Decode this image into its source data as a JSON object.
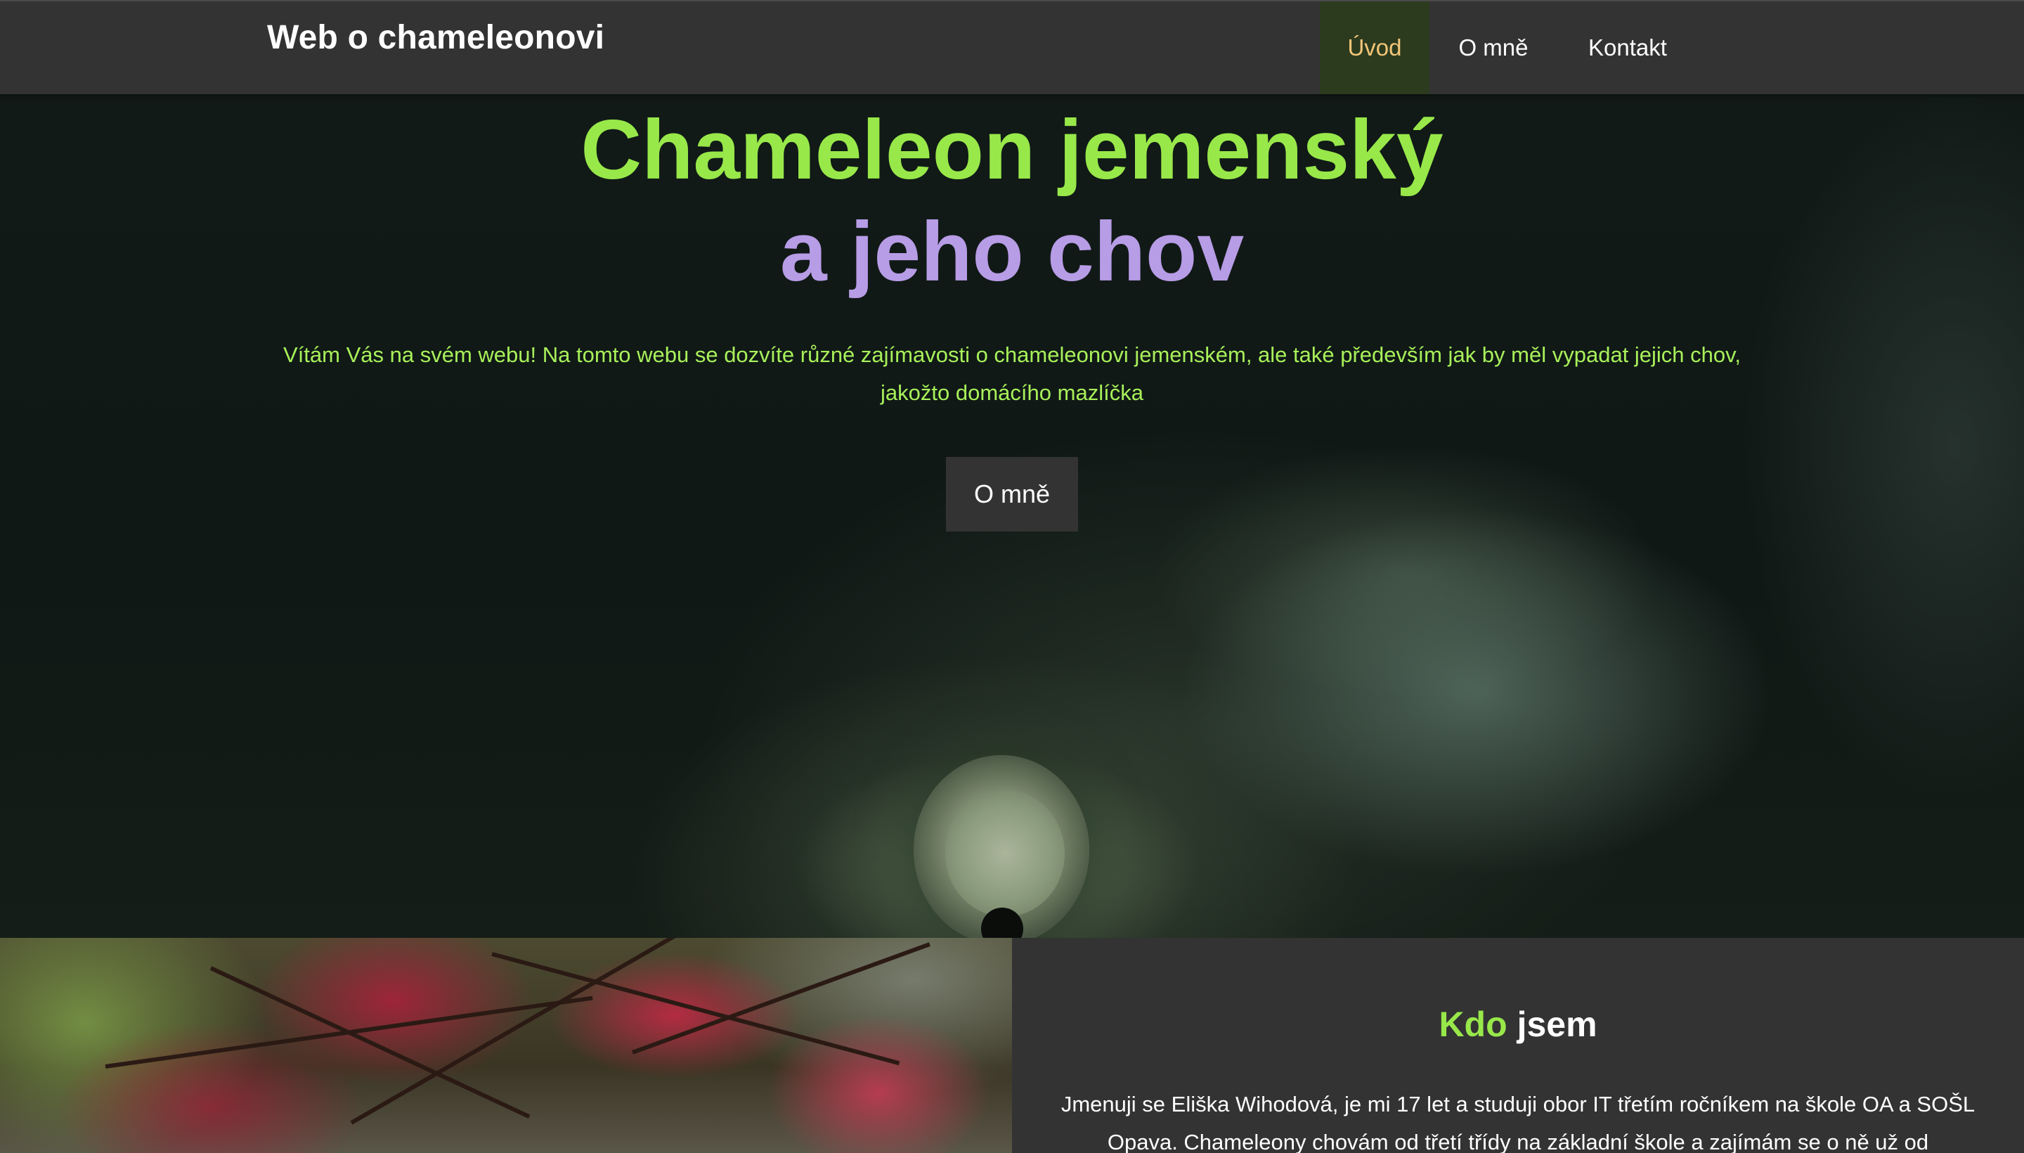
{
  "navbar": {
    "brand": "Web o chameleonovi",
    "items": [
      {
        "label": "Úvod",
        "active": true
      },
      {
        "label": "O mně",
        "active": false
      },
      {
        "label": "Kontakt",
        "active": false
      }
    ],
    "active_bg": "#2c3b1e",
    "active_color": "#f2c679"
  },
  "hero": {
    "title_line1": "Chameleon jemenský",
    "title_line2": "a jeho chov",
    "text": "Vítám Vás na svém webu! Na tomto webu se dozvíte různé zajímavosti o chameleonovi jemenském, ale také především jak by měl vypadat jejich chov, jakožto domácího mazlíčka",
    "button": "O mně",
    "title1_color": "#98e84a",
    "title2_color": "#b79ce6"
  },
  "about": {
    "title_green": "Kdo",
    "title_white": "jsem",
    "text": "Jmenuji se Eliška Wihodová, je mi 17 let a studuji obor IT třetím ročníkem na škole OA a SOŠL Opava. Chameleony chovám od třetí třídy na základní škole a zajímám se o ně už od"
  }
}
